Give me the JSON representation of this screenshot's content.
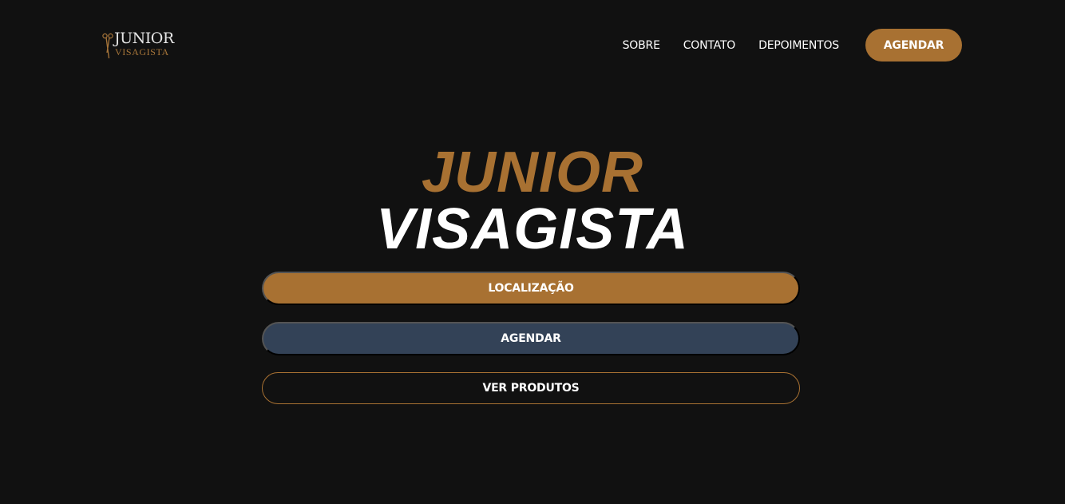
{
  "colors": {
    "background": "#111111",
    "accent": "#a87132",
    "secondary_button": "#334257",
    "text": "#ffffff"
  },
  "logo": {
    "line1": "JUNIOR",
    "line2": "VISAGISTA",
    "icon": "scissors-icon"
  },
  "nav": {
    "items": [
      {
        "label": "SOBRE"
      },
      {
        "label": "CONTATO"
      },
      {
        "label": "DEPOIMENTOS"
      }
    ],
    "cta_label": "AGENDAR"
  },
  "hero": {
    "title_line1": "JUNIOR",
    "title_line2": "VISAGISTA"
  },
  "actions": {
    "location_label": "LOCALIZAÇÃO",
    "schedule_label": "AGENDAR",
    "products_label": "VER PRODUTOS"
  }
}
